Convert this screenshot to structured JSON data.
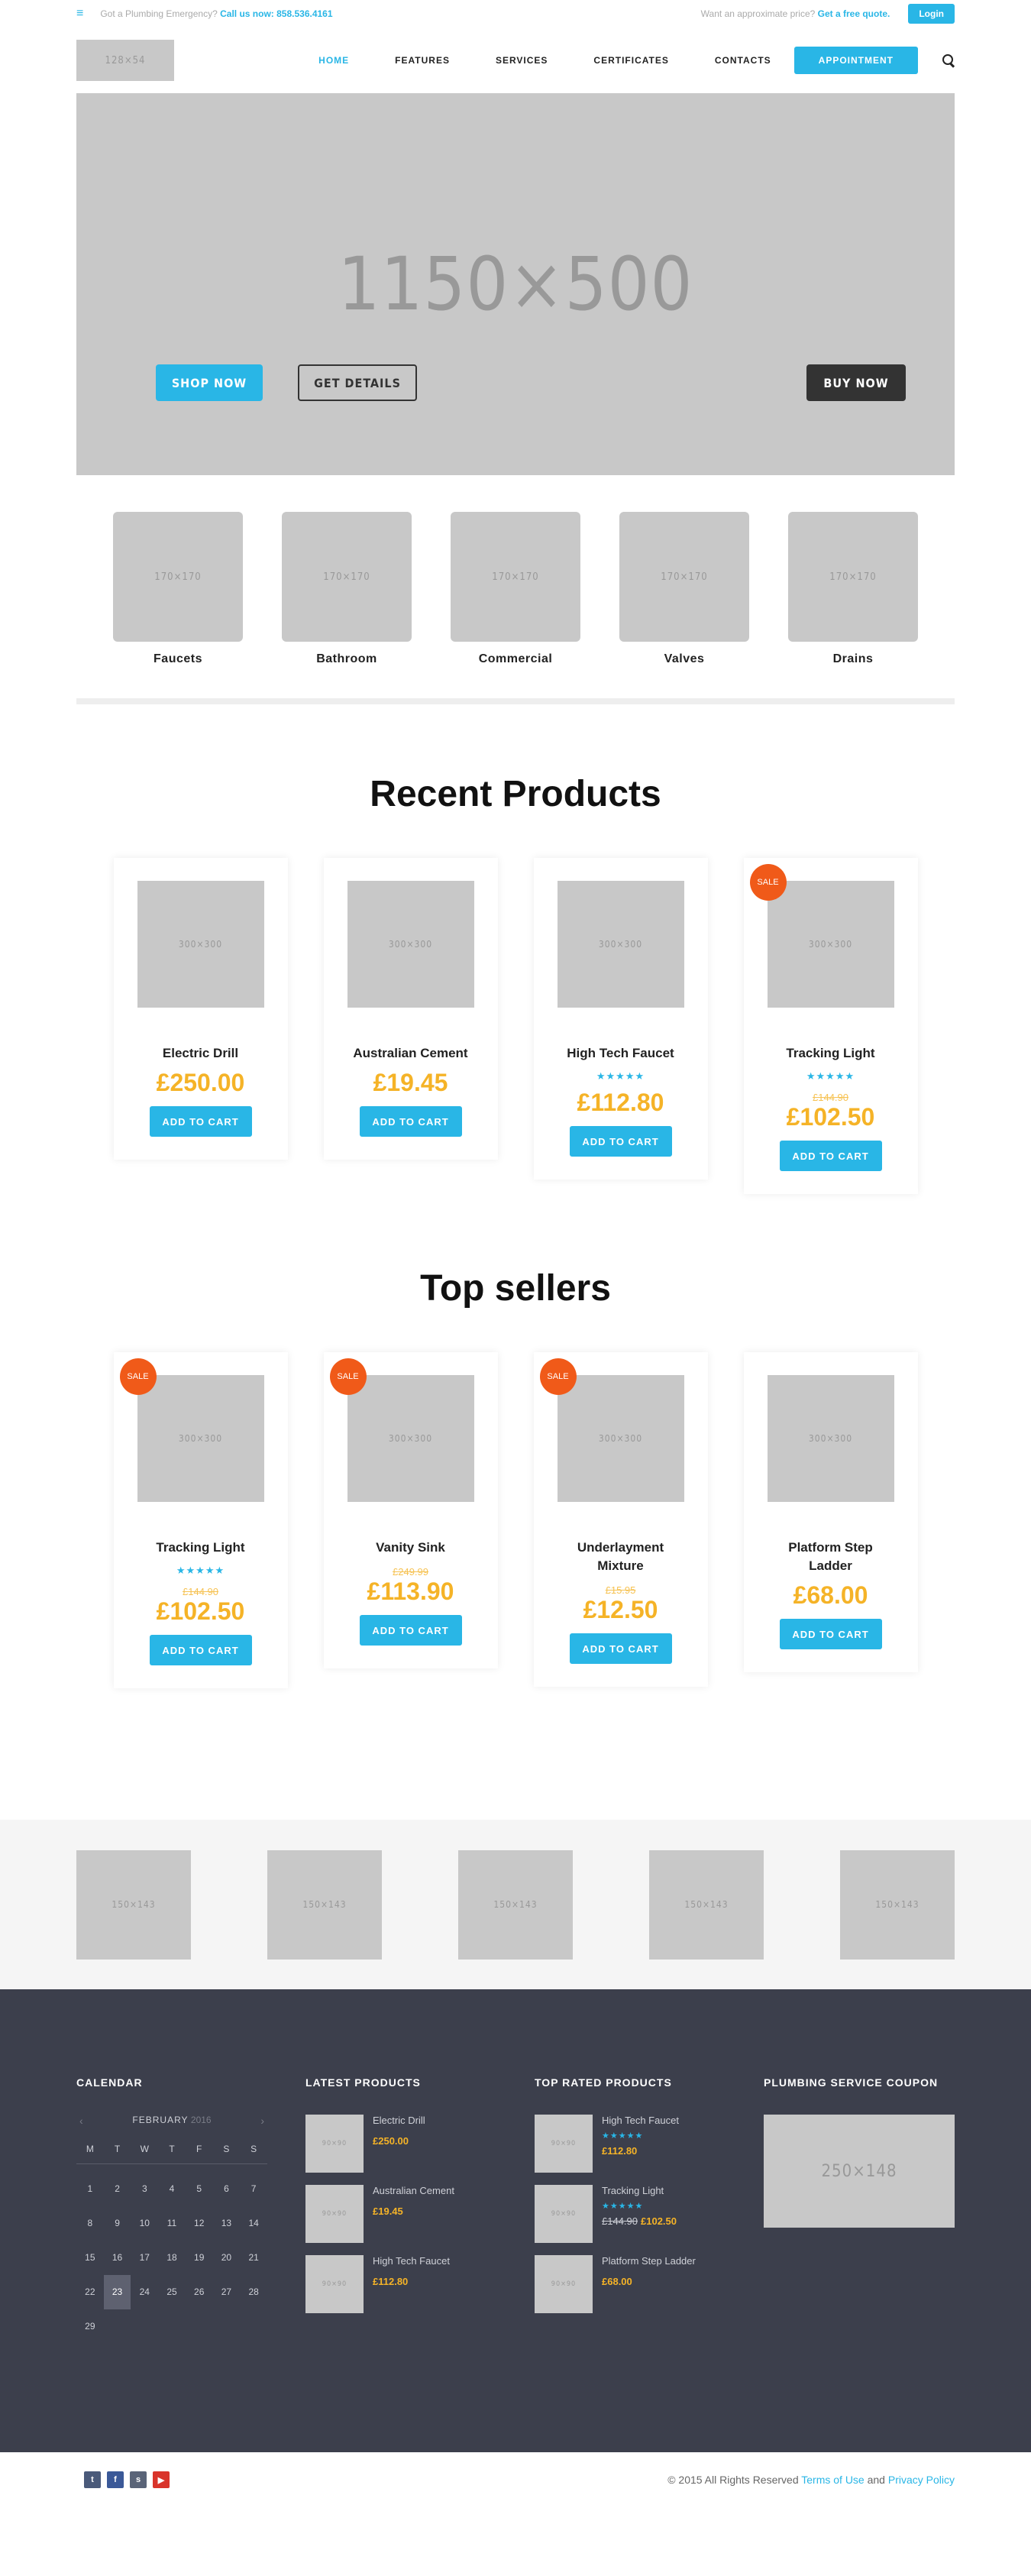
{
  "topbar": {
    "emergency": "Got a Plumbing Emergency?",
    "call_label": "Call us now:",
    "phone": "858.536.4161",
    "quote_prompt": "Want an approximate price?",
    "quote_link": "Get a free quote.",
    "login": "Login"
  },
  "header": {
    "logo": "128×54",
    "nav": [
      {
        "label": "HOME"
      },
      {
        "label": "FEATURES"
      },
      {
        "label": "SERVICES"
      },
      {
        "label": "CERTIFICATES"
      },
      {
        "label": "CONTACTS"
      }
    ],
    "appointment": "APPOINTMENT"
  },
  "hero": {
    "image": "1150×500",
    "shop_now": "SHOP NOW",
    "get_details": "GET DETAILS",
    "buy_now": "BUY NOW"
  },
  "categories": [
    {
      "image": "170×170",
      "name": "Faucets"
    },
    {
      "image": "170×170",
      "name": "Bathroom"
    },
    {
      "image": "170×170",
      "name": "Commercial"
    },
    {
      "image": "170×170",
      "name": "Valves"
    },
    {
      "image": "170×170",
      "name": "Drains"
    }
  ],
  "recent": {
    "title": "Recent Products",
    "items": [
      {
        "image": "300×300",
        "name": "Electric Drill",
        "price": "£250.00",
        "cart": "ADD TO CART"
      },
      {
        "image": "300×300",
        "name": "Australian Cement",
        "price": "£19.45",
        "cart": "ADD TO CART"
      },
      {
        "image": "300×300",
        "name": "High Tech Faucet",
        "stars": "★★★★★",
        "price": "£112.80",
        "cart": "ADD TO CART"
      },
      {
        "image": "300×300",
        "name": "Tracking Light",
        "sale": "SALE",
        "stars": "★★★★★",
        "old": "£144.90",
        "price": "£102.50",
        "cart": "ADD TO CART"
      }
    ]
  },
  "top": {
    "title": "Top sellers",
    "items": [
      {
        "image": "300×300",
        "name": "Tracking Light",
        "sale": "SALE",
        "stars": "★★★★★",
        "old": "£144.90",
        "price": "£102.50",
        "cart": "ADD TO CART"
      },
      {
        "image": "300×300",
        "name": "Vanity Sink",
        "sale": "SALE",
        "old": "£249.99",
        "price": "£113.90",
        "cart": "ADD TO CART"
      },
      {
        "image": "300×300",
        "name": "Underlayment Mixture",
        "sale": "SALE",
        "old": "£15.95",
        "price": "£12.50",
        "cart": "ADD TO CART"
      },
      {
        "image": "300×300",
        "name": "Platform Step Ladder",
        "price": "£68.00",
        "cart": "ADD TO CART"
      }
    ]
  },
  "brands": [
    "150×143",
    "150×143",
    "150×143",
    "150×143",
    "150×143"
  ],
  "footer": {
    "calendar": {
      "title": "CALENDAR",
      "month": "FEBRUARY",
      "year": "2016",
      "dows": [
        "M",
        "T",
        "W",
        "T",
        "F",
        "S",
        "S"
      ],
      "days": [
        "1",
        "2",
        "3",
        "4",
        "5",
        "6",
        "7",
        "8",
        "9",
        "10",
        "11",
        "12",
        "13",
        "14",
        "15",
        "16",
        "17",
        "18",
        "19",
        "20",
        "21",
        "22",
        "23",
        "24",
        "25",
        "26",
        "27",
        "28",
        "29"
      ],
      "today": "23"
    },
    "latest": {
      "title": "LATEST PRODUCTS",
      "items": [
        {
          "image": "90×90",
          "name": "Electric Drill",
          "price": "£250.00"
        },
        {
          "image": "90×90",
          "name": "Australian Cement",
          "price": "£19.45"
        },
        {
          "image": "90×90",
          "name": "High Tech Faucet",
          "price": "£112.80"
        }
      ]
    },
    "rated": {
      "title": "TOP RATED PRODUCTS",
      "items": [
        {
          "image": "90×90",
          "name": "High Tech Faucet",
          "stars": "★★★★★",
          "price": "£112.80"
        },
        {
          "image": "90×90",
          "name": "Tracking Light",
          "stars": "★★★★★",
          "old": "£144.90",
          "price": "£102.50"
        },
        {
          "image": "90×90",
          "name": "Platform Step Ladder",
          "price": "£68.00"
        }
      ]
    },
    "coupon": {
      "title": "PLUMBING SERVICE COUPON",
      "image": "250×148"
    }
  },
  "bottom": {
    "copyright": "© 2015 All Rights Reserved",
    "terms": "Terms of Use",
    "and": "and",
    "privacy": "Privacy Policy",
    "socials": [
      {
        "glyph": "t",
        "color": "#4a5a7a"
      },
      {
        "glyph": "f",
        "color": "#3b5998"
      },
      {
        "glyph": "s",
        "color": "#5a6478"
      },
      {
        "glyph": "▶",
        "color": "#d9342b"
      }
    ]
  },
  "colors": {
    "accent": "#29b6e6",
    "price": "#f5b327",
    "sale": "#f05a19",
    "footer_bg": "#3c3f4c"
  }
}
